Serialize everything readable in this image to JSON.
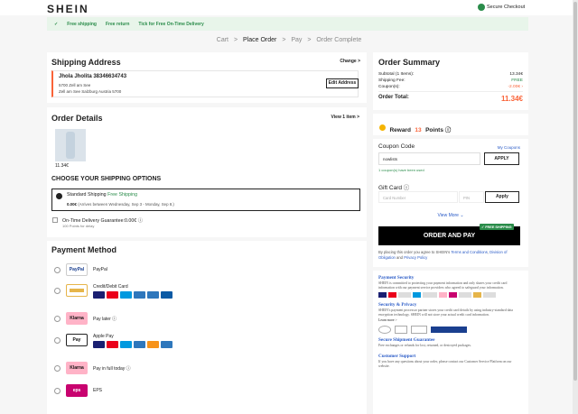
{
  "header": {
    "logo": "SHEIN",
    "secure": "Secure Checkout"
  },
  "promo": {
    "items": [
      "✓",
      "Free shipping",
      "Free return",
      "Tick for Free On-Time Delivery"
    ]
  },
  "steps": [
    {
      "label": "Cart"
    },
    {
      "label": ">"
    },
    {
      "label": "Place Order"
    },
    {
      "label": ">"
    },
    {
      "label": "Pay"
    },
    {
      "label": ">"
    },
    {
      "label": "Order Complete"
    }
  ],
  "shipping": {
    "title": "Shipping Address",
    "change": "Change >",
    "name": "Jhola Jholita 38346634743",
    "line1": "5700 Zell am See",
    "line2": "Zell am See Salzburg Austria 5700",
    "edit": "Edit Address"
  },
  "order": {
    "title": "Order Details",
    "view": "View 1 item >",
    "price": "11.34€",
    "ship_title": "CHOOSE YOUR SHIPPING OPTIONS",
    "std_label": "Standard Shipping",
    "std_free": "Free Shipping",
    "std_price": "0.00€",
    "std_eta": "(Arrives between Wednesday, Sep 3 - Monday, Sep 8.)",
    "ontime_label": "On-Time Delivery Guarantee:0.00€ ⓘ",
    "ontime_sub": "100 Points for delay"
  },
  "payment": {
    "title": "Payment Method",
    "methods": [
      {
        "name": "PayPal",
        "logo": "PayPal"
      },
      {
        "name": "Credit/Debit Card",
        "logo": ""
      },
      {
        "name": "Pay later ⓘ",
        "logo": "Klarna"
      },
      {
        "name": "Apple Pay",
        "logo": "Pay"
      },
      {
        "name": "Pay in full today ⓘ",
        "logo": "Klarna"
      },
      {
        "name": "EPS",
        "logo": "eps"
      }
    ]
  },
  "summary": {
    "title": "Order Summary",
    "rows": [
      {
        "label": "Subtotal (1 Items):",
        "value": "13.34€"
      },
      {
        "label": "Shipping Fee:",
        "value": "FREE"
      },
      {
        "label": "Coupon(s):",
        "value": "-2.00€ ›"
      }
    ],
    "total_label": "Order Total:",
    "total_value": "11.34€"
  },
  "reward": {
    "label": "Reward",
    "points": "13",
    "suffix": "Points ⓘ"
  },
  "coupon": {
    "title": "Coupon Code",
    "my": "My Coupons",
    "value": "nowlists",
    "apply": "APPLY",
    "note": "1 coupon(s) have been used"
  },
  "gift": {
    "title": "Gift Card ⓘ",
    "card": "Card Number",
    "pin": "PIN",
    "apply": "Apply"
  },
  "more": "View More ⌄",
  "pay_button": "ORDER AND PAY",
  "free_ship_tag": "✓ FREE SHIPPING",
  "terms": {
    "pre": "By placing this order you agree to SHEIN's",
    "terms": "Terms and Conditions",
    "mid": ", ",
    "div": "Division of Obligation",
    "and": " and ",
    "privacy": "Privacy Policy"
  },
  "info": {
    "payment_title": "Payment Security",
    "payment_text": "SHEIN is committed to protecting your payment information and only shares your credit card information with our payment service providers who agreed to safeguard your information.",
    "privacy_title": "Security & Privacy",
    "privacy_text": "SHEIN's payment processor partner stores your credit card details by using industry-standard data encryption technology. SHEIN will not store your actual credit card information.",
    "learn": "Learn more >",
    "shipment_title": "Secure Shipment Guarantee",
    "shipment_text": "Free exchanges or refunds for lost, returned, or destroyed packages.",
    "support_title": "Customer Support",
    "support_text": "If you have any questions about your order, please contact our Customer Service Platform on our website."
  },
  "colors": {
    "accent": "#fa6338",
    "green": "#2a8c4a",
    "black": "#000000"
  }
}
